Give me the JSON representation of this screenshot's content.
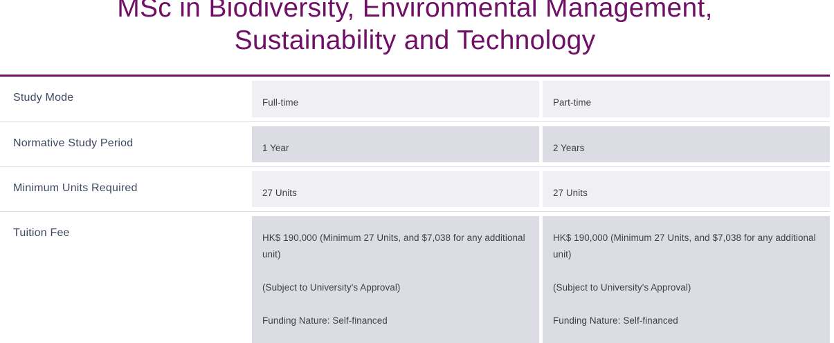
{
  "page": {
    "title_line1": "MSc in Biodiversity, Environmental Management,",
    "title_line2": "Sustainability and Technology"
  },
  "table": {
    "rows": [
      {
        "label": "Study Mode",
        "full_time": [
          "Full-time"
        ],
        "part_time": [
          "Part-time"
        ]
      },
      {
        "label": "Normative Study Period",
        "full_time": [
          "1 Year"
        ],
        "part_time": [
          "2 Years"
        ]
      },
      {
        "label": "Minimum Units Required",
        "full_time": [
          "27 Units"
        ],
        "part_time": [
          "27 Units"
        ]
      },
      {
        "label": "Tuition Fee",
        "full_time": [
          "HK$ 190,000 (Minimum 27 Units, and $7,038 for any additional unit)",
          "(Subject to University's Approval)",
          "Funding Nature: Self-financed"
        ],
        "part_time": [
          "HK$ 190,000 (Minimum 27 Units, and $7,038 for any additional unit)",
          "(Subject to University's Approval)",
          "Funding Nature: Self-financed"
        ]
      }
    ]
  }
}
